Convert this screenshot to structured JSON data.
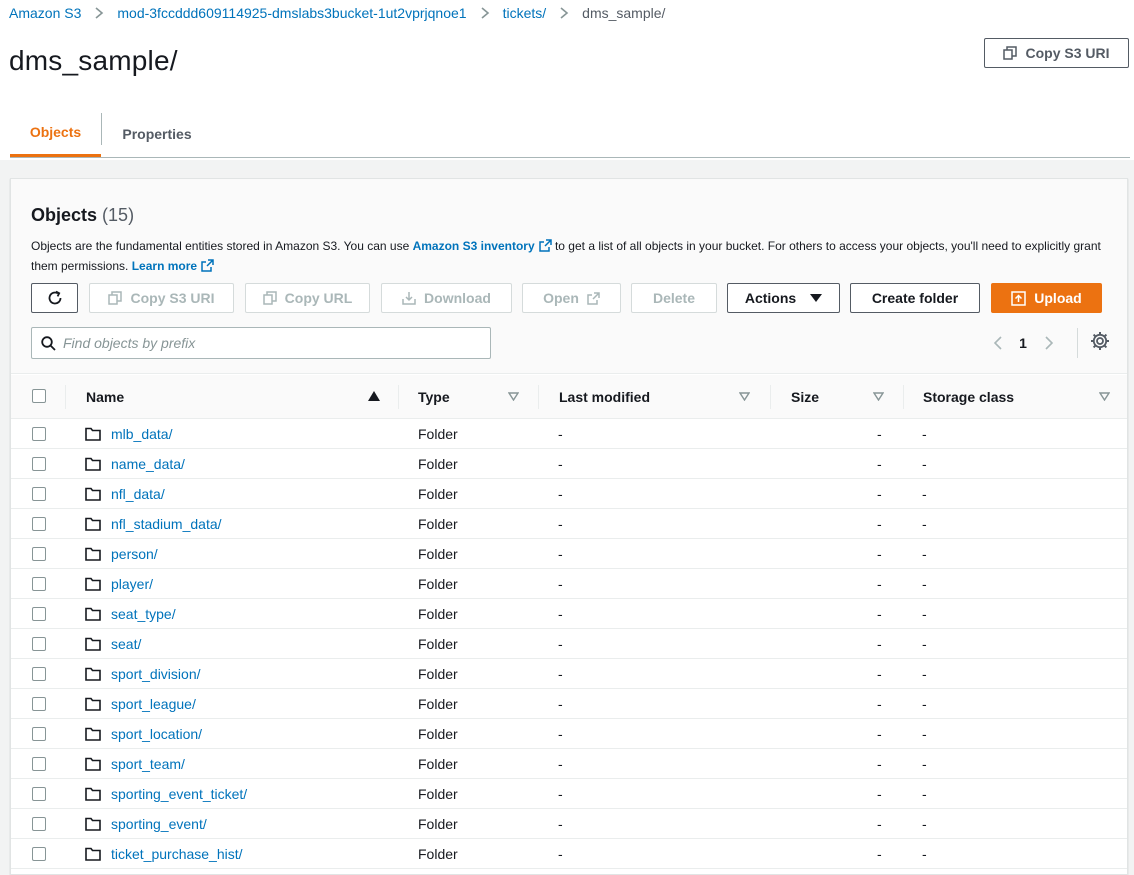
{
  "breadcrumb": {
    "items": [
      "Amazon S3",
      "mod-3fccddd609114925-dmslabs3bucket-1ut2vprjqnoe1",
      "tickets/"
    ],
    "current": "dms_sample/"
  },
  "page": {
    "title": "dms_sample/",
    "copy_uri_label": "Copy S3 URI"
  },
  "tabs": [
    {
      "label": "Objects",
      "active": true
    },
    {
      "label": "Properties",
      "active": false
    }
  ],
  "objects_panel": {
    "title": "Objects",
    "count": "(15)",
    "description_1": "Objects are the fundamental entities stored in Amazon S3. You can use",
    "inventory_link": "Amazon S3 inventory",
    "description_2": "to get a list of all objects in your bucket. For others to access your objects, you'll need to explicitly grant them permissions.",
    "learn_more": "Learn more"
  },
  "toolbar": {
    "copy_s3_uri": "Copy S3 URI",
    "copy_url": "Copy URL",
    "download": "Download",
    "open": "Open",
    "delete": "Delete",
    "actions": "Actions",
    "create_folder": "Create folder",
    "upload": "Upload"
  },
  "search": {
    "placeholder": "Find objects by prefix",
    "value": ""
  },
  "pagination": {
    "current_page": "1"
  },
  "table": {
    "columns": [
      "Name",
      "Type",
      "Last modified",
      "Size",
      "Storage class"
    ],
    "rows": [
      {
        "name": "mlb_data/",
        "type": "Folder",
        "last_modified": "-",
        "size": "-",
        "storage_class": "-"
      },
      {
        "name": "name_data/",
        "type": "Folder",
        "last_modified": "-",
        "size": "-",
        "storage_class": "-"
      },
      {
        "name": "nfl_data/",
        "type": "Folder",
        "last_modified": "-",
        "size": "-",
        "storage_class": "-"
      },
      {
        "name": "nfl_stadium_data/",
        "type": "Folder",
        "last_modified": "-",
        "size": "-",
        "storage_class": "-"
      },
      {
        "name": "person/",
        "type": "Folder",
        "last_modified": "-",
        "size": "-",
        "storage_class": "-"
      },
      {
        "name": "player/",
        "type": "Folder",
        "last_modified": "-",
        "size": "-",
        "storage_class": "-"
      },
      {
        "name": "seat_type/",
        "type": "Folder",
        "last_modified": "-",
        "size": "-",
        "storage_class": "-"
      },
      {
        "name": "seat/",
        "type": "Folder",
        "last_modified": "-",
        "size": "-",
        "storage_class": "-"
      },
      {
        "name": "sport_division/",
        "type": "Folder",
        "last_modified": "-",
        "size": "-",
        "storage_class": "-"
      },
      {
        "name": "sport_league/",
        "type": "Folder",
        "last_modified": "-",
        "size": "-",
        "storage_class": "-"
      },
      {
        "name": "sport_location/",
        "type": "Folder",
        "last_modified": "-",
        "size": "-",
        "storage_class": "-"
      },
      {
        "name": "sport_team/",
        "type": "Folder",
        "last_modified": "-",
        "size": "-",
        "storage_class": "-"
      },
      {
        "name": "sporting_event_ticket/",
        "type": "Folder",
        "last_modified": "-",
        "size": "-",
        "storage_class": "-"
      },
      {
        "name": "sporting_event/",
        "type": "Folder",
        "last_modified": "-",
        "size": "-",
        "storage_class": "-"
      },
      {
        "name": "ticket_purchase_hist/",
        "type": "Folder",
        "last_modified": "-",
        "size": "-",
        "storage_class": "-"
      }
    ]
  },
  "colors": {
    "accent": "#ec7211",
    "link": "#0073bb",
    "text": "#16191f",
    "muted": "#545b64",
    "disabled": "#aab7b8"
  },
  "icons": [
    "chevron-right-icon",
    "copy-icon",
    "refresh-icon",
    "download-icon",
    "external-link-icon",
    "caret-down-icon",
    "upload-icon",
    "search-icon",
    "chevron-left-icon",
    "gear-icon",
    "sort-ascending-icon",
    "sort-icon",
    "folder-icon"
  ]
}
